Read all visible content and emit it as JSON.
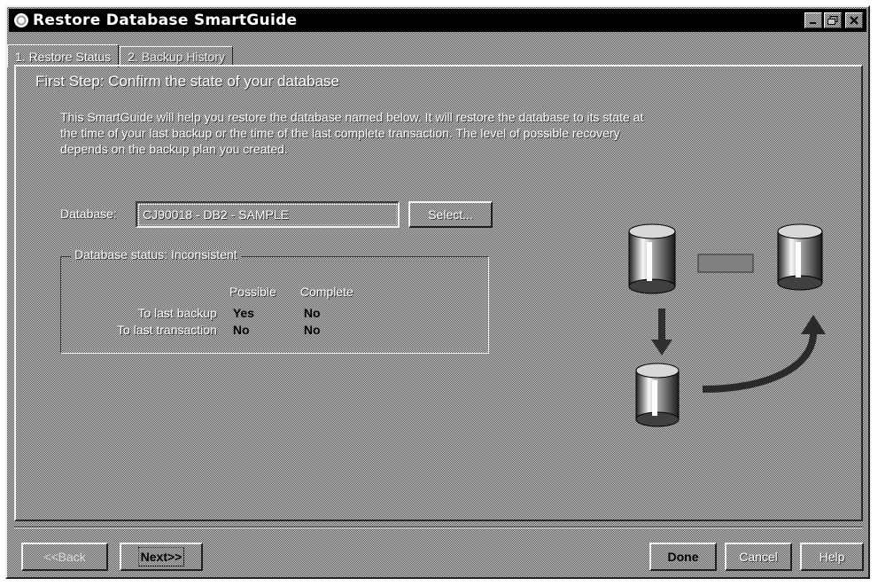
{
  "window": {
    "title": "Restore Database SmartGuide",
    "controls": [
      "minimize",
      "maximize",
      "close"
    ]
  },
  "tabs": [
    {
      "label": "1. Restore Status",
      "active": true
    },
    {
      "label": "2. Backup History",
      "active": false
    }
  ],
  "step": {
    "title": "First Step: Confirm the state of your database",
    "intro": "This SmartGuide will help you restore the database named below. It will restore the database to its state at the time of your last backup or the time of the last complete transaction. The level of possible recovery depends on the backup plan you created."
  },
  "database": {
    "label": "Database:",
    "value": "CJ90018 - DB2 - SAMPLE",
    "select_label": "Select..."
  },
  "status": {
    "legend": "Database status: Inconsistent",
    "columns": [
      "Possible",
      "Complete"
    ],
    "rows": [
      {
        "label": "To last backup",
        "possible": "Yes",
        "complete": "No"
      },
      {
        "label": "To last transaction",
        "possible": "No",
        "complete": "No"
      }
    ]
  },
  "illustration": {
    "icons": [
      "database-cylinder-icon",
      "backup-tape-icon",
      "arrow-down-icon",
      "curved-arrow-icon"
    ]
  },
  "footer": {
    "back": "<<Back",
    "next": "Next>>",
    "done": "Done",
    "cancel": "Cancel",
    "help": "Help"
  },
  "colors": {
    "titlebar": "#000000",
    "face_light": "#c8c8c8",
    "face_dark": "#5a5a5a",
    "highlight": "#f4f4f4",
    "shadow": "#1e1e1e"
  }
}
